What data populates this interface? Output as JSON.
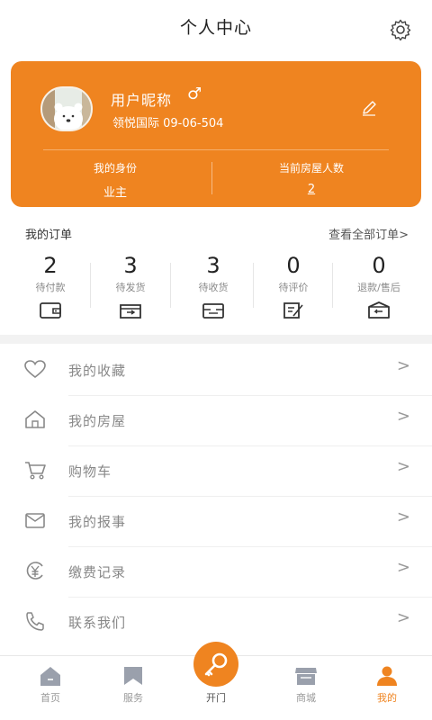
{
  "header": {
    "title": "个人中心",
    "settings_icon": "gear-icon"
  },
  "profile": {
    "nickname": "用户昵称",
    "gender_symbol": "♂",
    "address": "领悦国际 09-06-504",
    "identity_label": "我的身份",
    "identity_value": "业主",
    "residents_label": "当前房屋人数",
    "residents_value": "2",
    "accent_color": "#ef8420"
  },
  "orders": {
    "title": "我的订单",
    "view_all": "查看全部订单>",
    "items": [
      {
        "count": "2",
        "label": "待付款",
        "icon": "wallet-icon"
      },
      {
        "count": "3",
        "label": "待发货",
        "icon": "ship-box-icon"
      },
      {
        "count": "3",
        "label": "待收货",
        "icon": "receive-box-icon"
      },
      {
        "count": "0",
        "label": "待评价",
        "icon": "review-icon"
      },
      {
        "count": "0",
        "label": "退款/售后",
        "icon": "refund-icon"
      }
    ]
  },
  "menu": {
    "items": [
      {
        "label": "我的收藏",
        "icon": "heart-icon"
      },
      {
        "label": "我的房屋",
        "icon": "house-icon"
      },
      {
        "label": "购物车",
        "icon": "cart-icon"
      },
      {
        "label": "我的报事",
        "icon": "mail-icon"
      },
      {
        "label": "缴费记录",
        "icon": "yuan-icon"
      },
      {
        "label": "联系我们",
        "icon": "phone-icon"
      }
    ],
    "arrow": ">"
  },
  "tabbar": {
    "items": [
      {
        "label": "首页",
        "icon": "home-icon"
      },
      {
        "label": "服务",
        "icon": "flag-icon"
      },
      {
        "label": "开门",
        "icon": "key-icon"
      },
      {
        "label": "商城",
        "icon": "shop-icon"
      },
      {
        "label": "我的",
        "icon": "user-icon"
      }
    ],
    "active_index": 4
  }
}
